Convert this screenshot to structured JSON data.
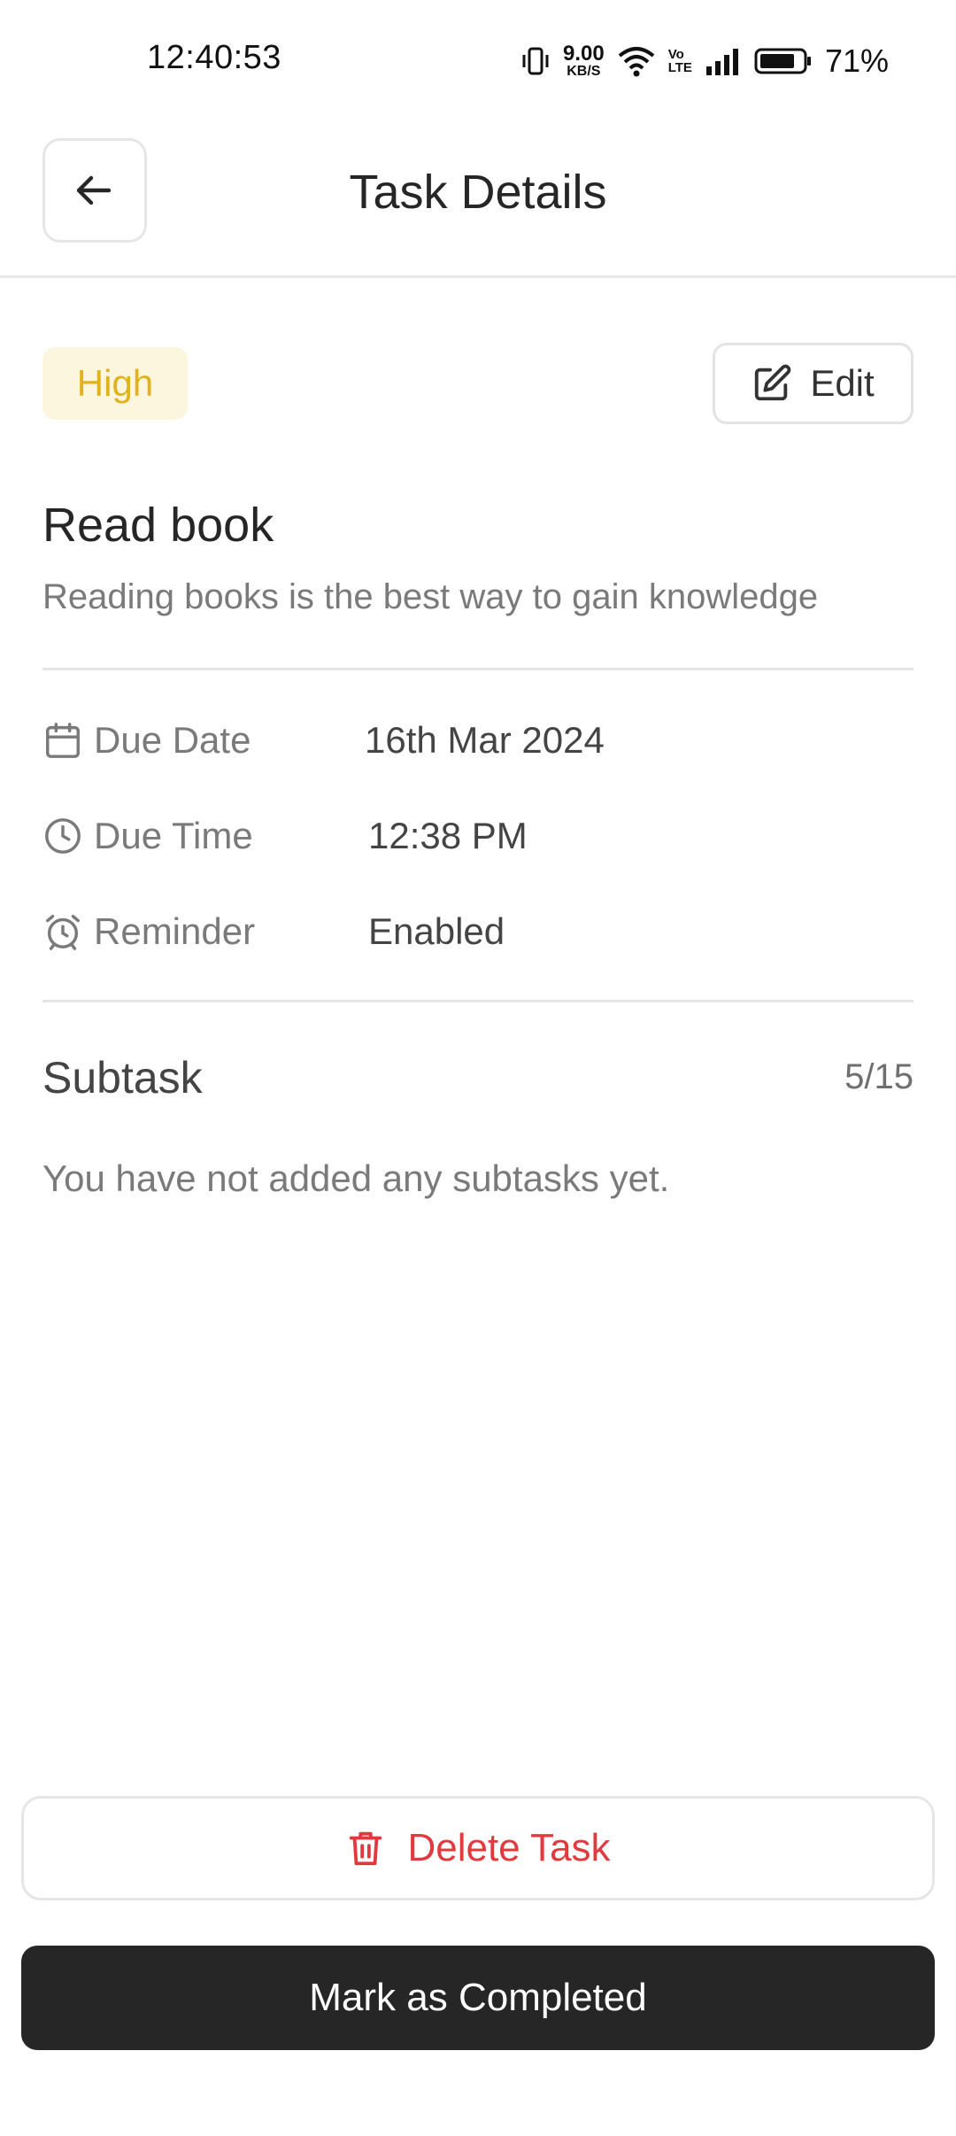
{
  "status_bar": {
    "time": "12:40:53",
    "speed_value": "9.00",
    "speed_unit": "KB/S",
    "volte_top": "Vo",
    "volte_bottom": "LTE",
    "battery_percent": "71%"
  },
  "header": {
    "title": "Task Details",
    "back_icon": "arrow-left-icon"
  },
  "task": {
    "priority": "High",
    "priority_color": "#e0b21d",
    "edit_label": "Edit",
    "title": "Read book",
    "description": "Reading books is the best way to gain knowledge"
  },
  "details": {
    "due_date_label": "Due Date",
    "due_date_value": "16th Mar 2024",
    "due_time_label": "Due Time",
    "due_time_value": "12:38 PM",
    "reminder_label": "Reminder",
    "reminder_value": "Enabled"
  },
  "subtask": {
    "title": "Subtask",
    "count": "5/15",
    "empty_message": "You have not added any subtasks yet."
  },
  "actions": {
    "delete_label": "Delete Task",
    "delete_color": "#e0393e",
    "complete_label": "Mark as Completed"
  }
}
